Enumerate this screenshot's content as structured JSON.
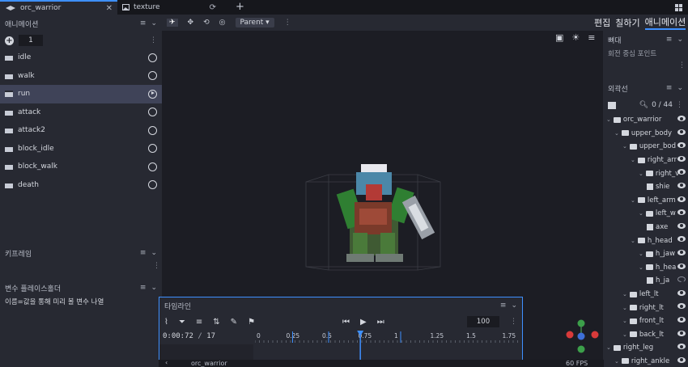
{
  "tabs": [
    {
      "label": "orc_warrior",
      "active": true
    },
    {
      "label": "texture",
      "active": false
    }
  ],
  "toolbar": {
    "parent_label": "Parent"
  },
  "modes": {
    "edit": "편집",
    "paint": "칠하기",
    "animate": "애니메이션"
  },
  "animations_panel": {
    "title": "애니메이션",
    "count_value": "1",
    "items": [
      {
        "label": "idle",
        "selected": false
      },
      {
        "label": "walk",
        "selected": false
      },
      {
        "label": "run",
        "selected": true
      },
      {
        "label": "attack",
        "selected": false
      },
      {
        "label": "attack2",
        "selected": false
      },
      {
        "label": "block_idle",
        "selected": false
      },
      {
        "label": "block_walk",
        "selected": false
      },
      {
        "label": "death",
        "selected": false
      }
    ]
  },
  "keyframe_panel": {
    "title": "키프레임"
  },
  "placeholder_panel": {
    "title": "변수 플레이스홀더",
    "hint": "이름=값을 통해 미리 볼 변수 나열"
  },
  "bone_panel": {
    "title": "뼈대",
    "pivot_label": "회전 중심 포인트"
  },
  "outliner": {
    "title": "외곽선",
    "count": "0 / 44",
    "items": [
      {
        "label": "orc_warrior",
        "depth": 0,
        "kind": "folder",
        "visible": true
      },
      {
        "label": "upper_body",
        "depth": 1,
        "kind": "folder",
        "visible": true
      },
      {
        "label": "upper_bod",
        "depth": 2,
        "kind": "folder",
        "visible": true
      },
      {
        "label": "right_arr",
        "depth": 3,
        "kind": "folder",
        "visible": true
      },
      {
        "label": "right_v",
        "depth": 4,
        "kind": "folder",
        "visible": true
      },
      {
        "label": "shie",
        "depth": 5,
        "kind": "cube",
        "visible": true
      },
      {
        "label": "left_arm",
        "depth": 3,
        "kind": "folder",
        "visible": true
      },
      {
        "label": "left_w",
        "depth": 4,
        "kind": "folder",
        "visible": true
      },
      {
        "label": "axe",
        "depth": 5,
        "kind": "cube",
        "visible": true
      },
      {
        "label": "h_head",
        "depth": 3,
        "kind": "folder",
        "visible": true
      },
      {
        "label": "h_jaw",
        "depth": 4,
        "kind": "folder",
        "visible": true
      },
      {
        "label": "h_hea",
        "depth": 4,
        "kind": "folder",
        "visible": true
      },
      {
        "label": "h_ja",
        "depth": 5,
        "kind": "cube",
        "visible": false
      },
      {
        "label": "left_lt",
        "depth": 2,
        "kind": "folder",
        "visible": true
      },
      {
        "label": "right_lt",
        "depth": 2,
        "kind": "folder",
        "visible": true
      },
      {
        "label": "front_lt",
        "depth": 2,
        "kind": "folder",
        "visible": true
      },
      {
        "label": "back_lt",
        "depth": 2,
        "kind": "folder",
        "visible": true
      },
      {
        "label": "right_leg",
        "depth": 0,
        "kind": "folder",
        "visible": true
      },
      {
        "label": "right_ankle",
        "depth": 1,
        "kind": "folder",
        "visible": true
      }
    ]
  },
  "timeline": {
    "title": "타임라인",
    "time_current": "0:00:72",
    "time_total": "17",
    "frame_value": "100",
    "ruler_labels": [
      "0",
      "0.25",
      "0.5",
      "0.75",
      "1",
      "1.25",
      "1.5",
      "1.75"
    ],
    "playhead_position": 0.72
  },
  "status": {
    "model_name": "orc_warrior",
    "fps": "60 FPS"
  },
  "colors": {
    "accent": "#3e90ff",
    "panel": "#272932",
    "viewport": "#1c1d24"
  }
}
